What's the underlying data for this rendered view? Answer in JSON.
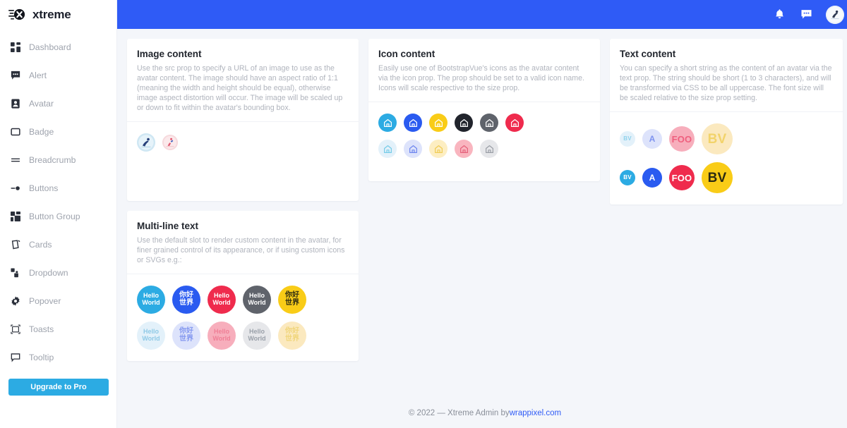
{
  "brand": {
    "name": "xtreme",
    "logo_icon": "xtreme-x-logo"
  },
  "sidebar": {
    "items": [
      {
        "label": "Dashboard",
        "icon": "grid-icon"
      },
      {
        "label": "Alert",
        "icon": "chat-square-icon"
      },
      {
        "label": "Avatar",
        "icon": "person-badge-icon"
      },
      {
        "label": "Badge",
        "icon": "square-icon"
      },
      {
        "label": "Breadcrumb",
        "icon": "list-icon"
      },
      {
        "label": "Buttons",
        "icon": "toggle-icon"
      },
      {
        "label": "Button Group",
        "icon": "layout-grid-icon"
      },
      {
        "label": "Cards",
        "icon": "card-icon"
      },
      {
        "label": "Dropdown",
        "icon": "layers-icon"
      },
      {
        "label": "Popover",
        "icon": "gear-icon"
      },
      {
        "label": "Toasts",
        "icon": "toast-icon"
      },
      {
        "label": "Tooltip",
        "icon": "tooltip-icon"
      }
    ],
    "upgrade_button": "Upgrade to Pro"
  },
  "topbar": {
    "notification_icon": "bell-icon",
    "messages_icon": "chat-icon",
    "profile_avatar": "user-avatar"
  },
  "cards": {
    "image_content": {
      "title": "Image content",
      "description": "Use the src prop to specify a URL of an image to use as the avatar content. The image should have an aspect ratio of 1:1 (meaning the width and height should be equal), otherwise image aspect distortion will occur. The image will be scaled up or down to fit within the avatar's bounding box.",
      "avatars": [
        {
          "name": "avatar-image-1",
          "size": 26,
          "bg": "#cfe7f3"
        },
        {
          "name": "avatar-image-2",
          "size": 22,
          "bg": "#f6d9dd"
        }
      ]
    },
    "icon_content": {
      "title": "Icon content",
      "description": "Easily use one of BootstrapVue's icons as the avatar content via the icon prop. The prop should be set to a valid icon name. Icons will scale respective to the size prop.",
      "icon_name": "house-icon",
      "row_solid": [
        {
          "variant": "info",
          "bg": "#2cabe3",
          "fg": "#ffffff",
          "size": 26
        },
        {
          "variant": "primary",
          "bg": "#2a5bf0",
          "fg": "#ffffff",
          "size": 26
        },
        {
          "variant": "warning",
          "bg": "#f9cc17",
          "fg": "#ffffff",
          "size": 26
        },
        {
          "variant": "dark",
          "bg": "#21242c",
          "fg": "#ffffff",
          "size": 26
        },
        {
          "variant": "secondary",
          "bg": "#5f636b",
          "fg": "#ffffff",
          "size": 26
        },
        {
          "variant": "danger",
          "bg": "#ef2b4d",
          "fg": "#ffffff",
          "size": 26
        }
      ],
      "row_light": [
        {
          "variant": "light-info",
          "bg": "#e3f1fa",
          "fg": "#76cce8",
          "size": 26
        },
        {
          "variant": "light-primary",
          "bg": "#dde3fb",
          "fg": "#6f87ef",
          "size": 26
        },
        {
          "variant": "light-warning",
          "bg": "#fdeec2",
          "fg": "#f0cc55",
          "size": 26
        },
        {
          "variant": "light-danger",
          "bg": "#f9b5bf",
          "fg": "#e5627b",
          "size": 26
        },
        {
          "variant": "light-secondary",
          "bg": "#e6e7ea",
          "fg": "#9a9ea6",
          "size": 26
        }
      ]
    },
    "text_content": {
      "title": "Text content",
      "description": "You can specify a short string as the content of an avatar via the text prop. The string should be short (1 to 3 characters), and will be transformed via CSS to be all uppercase. The font size will be scaled relative to the size prop setting.",
      "row_light": [
        {
          "text": "BV",
          "bg": "#e3f1fa",
          "fg": "#8fd2ec",
          "size": 22,
          "font": 8
        },
        {
          "text": "A",
          "bg": "#dde3fb",
          "fg": "#7e93ef",
          "size": 28,
          "font": 12
        },
        {
          "text": "FOO",
          "bg": "#f7aebc",
          "fg": "#ef5f7e",
          "size": 36,
          "font": 13
        },
        {
          "text": "BV",
          "bg": "#fbe9bf",
          "fg": "#f2d36a",
          "size": 44,
          "font": 19
        }
      ],
      "row_solid": [
        {
          "text": "BV",
          "bg": "#2cabe3",
          "fg": "#ffffff",
          "size": 22,
          "font": 8
        },
        {
          "text": "A",
          "bg": "#2a5bf0",
          "fg": "#ffffff",
          "size": 28,
          "font": 12
        },
        {
          "text": "FOO",
          "bg": "#ef2b4d",
          "fg": "#ffffff",
          "size": 36,
          "font": 13
        },
        {
          "text": "BV",
          "bg": "#f9cc17",
          "fg": "#2b2a12",
          "size": 44,
          "font": 19
        }
      ]
    },
    "multiline_text": {
      "title": "Multi-line text",
      "description": "Use the default slot to render custom content in the avatar, for finer grained control of its appearance, or if using custom icons or SVGs e.g.:",
      "row_solid": [
        {
          "line1": "Hello",
          "line2": "World",
          "bg": "#2cabe3",
          "fg": "#ffffff",
          "size": 40,
          "font": 9
        },
        {
          "line1": "你好",
          "line2": "世界",
          "bg": "#2a5bf0",
          "fg": "#ffffff",
          "size": 40,
          "font": 10
        },
        {
          "line1": "Hello",
          "line2": "World",
          "bg": "#ef2b4d",
          "fg": "#ffffff",
          "size": 40,
          "font": 9
        },
        {
          "line1": "Hello",
          "line2": "World",
          "bg": "#5f636b",
          "fg": "#ffffff",
          "size": 40,
          "font": 9
        },
        {
          "line1": "你好",
          "line2": "世界",
          "bg": "#f9cc17",
          "fg": "#2b2a12",
          "size": 40,
          "font": 10
        }
      ],
      "row_light": [
        {
          "line1": "Hello",
          "line2": "World",
          "bg": "#e3f1fa",
          "fg": "#8fc9e6",
          "size": 40,
          "font": 9
        },
        {
          "line1": "你好",
          "line2": "世界",
          "bg": "#dde3fb",
          "fg": "#8296ef",
          "size": 40,
          "font": 10
        },
        {
          "line1": "Hello",
          "line2": "World",
          "bg": "#f7aebc",
          "fg": "#ef7f96",
          "size": 40,
          "font": 9
        },
        {
          "line1": "Hello",
          "line2": "World",
          "bg": "#e6e7ea",
          "fg": "#9aa0a9",
          "size": 40,
          "font": 9
        },
        {
          "line1": "你好",
          "line2": "世界",
          "bg": "#fbe9bf",
          "fg": "#f0d579",
          "size": 40,
          "font": 10
        }
      ]
    }
  },
  "footer": {
    "prefix": "© 2022 — Xtreme Admin by ",
    "link": "wrappixel.com"
  }
}
